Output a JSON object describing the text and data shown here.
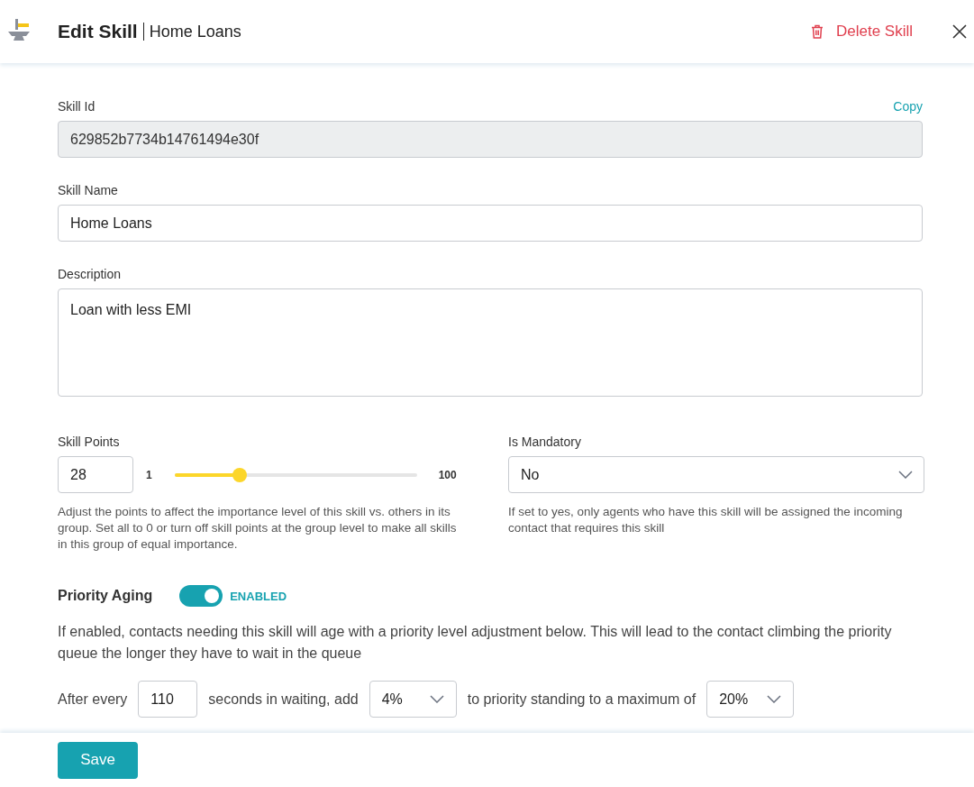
{
  "header": {
    "title": "Edit Skill",
    "subtitle": "Home Loans",
    "delete_label": "Delete Skill"
  },
  "skill_id": {
    "label": "Skill Id",
    "value": "629852b7734b14761494e30f",
    "copy_label": "Copy",
    "disabled": true
  },
  "skill_name": {
    "label": "Skill Name",
    "value": "Home Loans"
  },
  "description": {
    "label": "Description",
    "value": "Loan with less EMI"
  },
  "skill_points": {
    "label": "Skill Points",
    "value": "28",
    "min_label": "1",
    "max_label": "100",
    "level": 0.27,
    "help": "Adjust the points to affect the importance level of this skill vs. others in its group. Set all to 0 or turn off skill points at the group level to make all skills in this group of equal importance."
  },
  "is_mandatory": {
    "label": "Is Mandatory",
    "value": "No",
    "help": "If set to yes, only agents who have this skill will be assigned the incoming contact that requires this skill"
  },
  "priority_aging": {
    "label": "Priority Aging",
    "on": true,
    "state_label": "ENABLED",
    "help": "If enabled, contacts needing this skill will age with a priority level adjustment below. This will lead to the contact climbing the priority queue the longer they have to wait in the queue",
    "rule": [
      {
        "kind": "text",
        "text": "After every"
      },
      {
        "kind": "input",
        "value": "110"
      },
      {
        "kind": "text",
        "text": "seconds in waiting, add"
      },
      {
        "kind": "select",
        "value": "4%"
      },
      {
        "kind": "text",
        "text": "to priority standing to a maximum of"
      },
      {
        "kind": "select",
        "value": "20%"
      }
    ]
  },
  "footer": {
    "save_label": "Save"
  }
}
